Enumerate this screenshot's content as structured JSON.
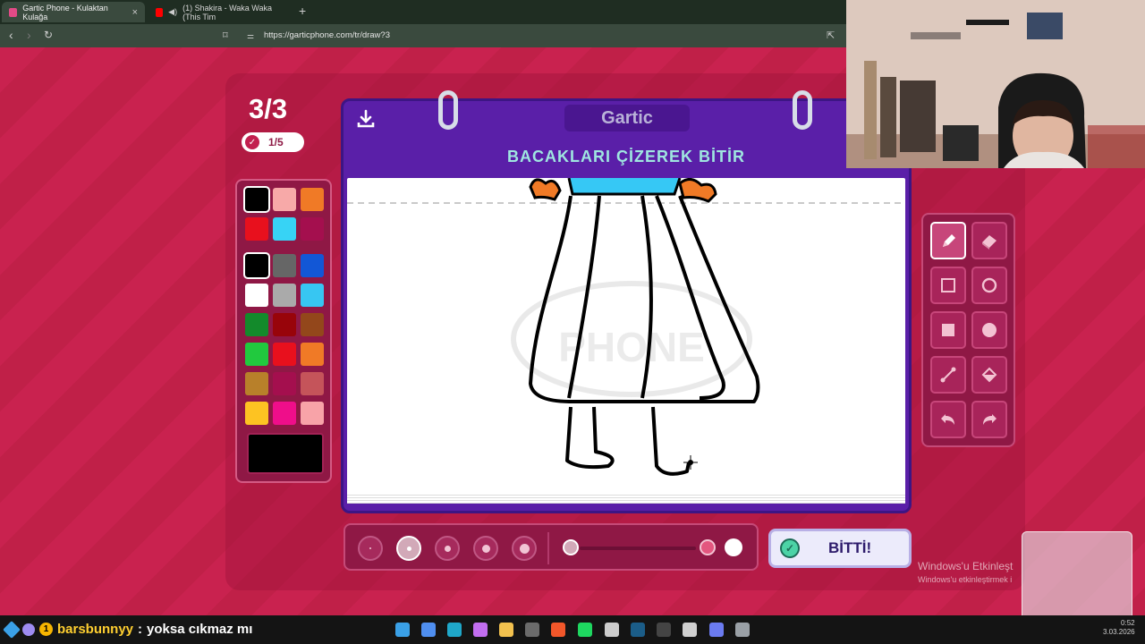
{
  "browser": {
    "tabs": [
      {
        "title": "Gartic Phone - Kulaktan Kulağa",
        "active": true
      },
      {
        "title": "(1) Shakira - Waka Waka (This Tim",
        "active": false
      }
    ],
    "new_tab_icon": "plus-icon",
    "url": "https://garticphone.com/tr/draw?3"
  },
  "game": {
    "round": "3/3",
    "progress": "1/5",
    "logo_text": "Gartic",
    "prompt": "BACAKLARI ÇİZEREK BİTİR",
    "done_label": "BİTTİ!",
    "colors": {
      "top": [
        "#000000",
        "#f7a9a8",
        "#f07a26",
        "#e8101d",
        "#37d3f5",
        "#a40f4e"
      ],
      "grid": [
        "#000000",
        "#666666",
        "#1257d6",
        "#ffffff",
        "#aaaaaa",
        "#37c6f2",
        "#138a2b",
        "#98040a",
        "#93471b",
        "#21c93e",
        "#e8101d",
        "#f07a26",
        "#b8802a",
        "#a40f4e",
        "#c5545a",
        "#fdc322",
        "#ef0e8a",
        "#f8a3a8"
      ],
      "current": "#000000"
    },
    "tools": [
      "pencil-icon",
      "eraser-icon",
      "rectangle-outline-icon",
      "circle-outline-icon",
      "rectangle-filled-icon",
      "circle-filled-icon",
      "line-icon",
      "bucket-icon",
      "undo-icon",
      "redo-icon"
    ],
    "selected_tool": "pencil-icon",
    "brush_sizes": 5,
    "selected_brush_size_index": 1
  },
  "windows": {
    "activation_title": "Windows'u Etkinleşt",
    "activation_sub": "Windows'u etkinleştirmek i"
  },
  "chat": {
    "user": "barsbunnyy",
    "separator": ":",
    "message": "yoksa cıkmaz mı",
    "badge_count": "1"
  },
  "clock": {
    "time": "0:52",
    "date": "3.03.2026"
  }
}
